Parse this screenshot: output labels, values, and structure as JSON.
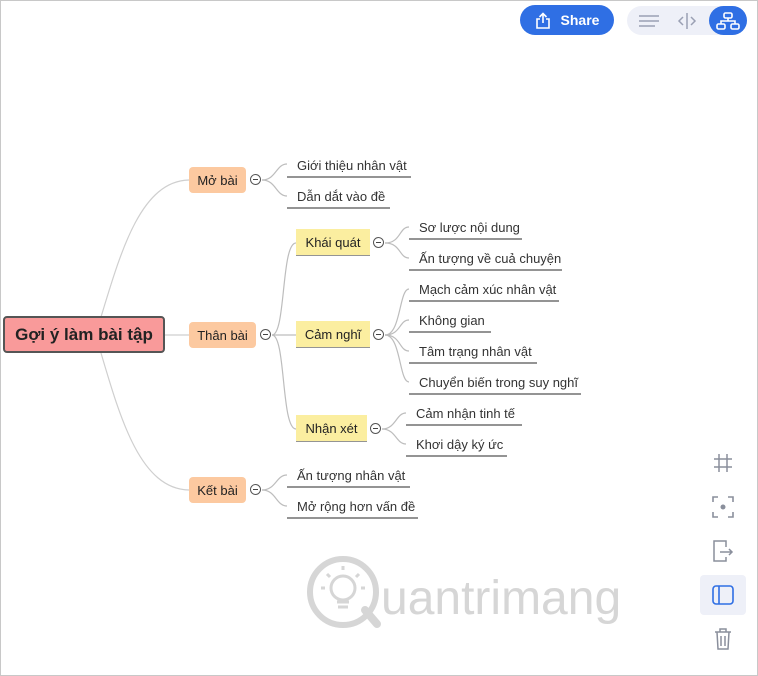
{
  "toolbar": {
    "share_label": "Share",
    "view_options": [
      "outline-icon",
      "split-icon",
      "mindmap-icon"
    ],
    "active_view": "mindmap-icon"
  },
  "mindmap": {
    "root": "Gợi ý làm bài tập",
    "branches": [
      {
        "label": "Mở bài",
        "children": [
          "Giới thiệu nhân vật",
          "Dẫn dắt vào đề"
        ]
      },
      {
        "label": "Thân bài",
        "children": [
          {
            "label": "Khái quát",
            "children": [
              "Sơ lược nội dung",
              "Ấn tượng về cuả chuyện"
            ]
          },
          {
            "label": "Cảm nghĩ",
            "children": [
              "Mạch cảm xúc nhân vật",
              "Không gian",
              "Tâm trạng nhân vật",
              "Chuyển biến trong suy nghĩ"
            ]
          },
          {
            "label": "Nhận xét",
            "children": [
              "Cảm nhận tinh tế",
              "Khơi dậy ký ức"
            ]
          }
        ]
      },
      {
        "label": "Kết bài",
        "children": [
          "Ấn tượng nhân vật",
          "Mở rộng hơn vấn đề"
        ]
      }
    ]
  },
  "side_tools": [
    "grid-icon",
    "focus-icon",
    "export-icon",
    "panel-icon",
    "trash-icon"
  ],
  "watermark": "uantrimang",
  "colors": {
    "accent": "#2f6fe4",
    "root": "#f99a9a",
    "main": "#fcc9a0",
    "sub": "#fbeea0"
  }
}
